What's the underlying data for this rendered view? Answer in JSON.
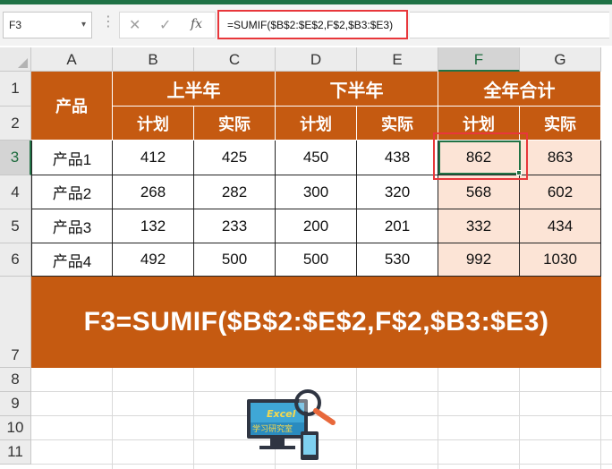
{
  "name_box": {
    "value": "F3",
    "dropdown_icon": "chevron-down-icon"
  },
  "formula_bar": {
    "cancel_icon": "cancel-x-icon",
    "enter_icon": "check-icon",
    "function_icon": "fx-icon",
    "fx_label": "fx",
    "formula": "=SUMIF($B$2:$E$2,F$2,$B3:$E3)"
  },
  "columns": [
    "A",
    "B",
    "C",
    "D",
    "E",
    "F",
    "G"
  ],
  "rows": [
    "1",
    "2",
    "3",
    "4",
    "5",
    "6",
    "7",
    "8",
    "9",
    "10",
    "11"
  ],
  "selected_column": "F",
  "selected_row": "3",
  "table": {
    "product_header": "产品",
    "groups": [
      "上半年",
      "下半年",
      "全年合计"
    ],
    "subheaders": [
      "计划",
      "实际",
      "计划",
      "实际",
      "计划",
      "实际"
    ],
    "data": [
      [
        "产品1",
        "412",
        "425",
        "450",
        "438",
        "862",
        "863"
      ],
      [
        "产品2",
        "268",
        "282",
        "300",
        "320",
        "568",
        "602"
      ],
      [
        "产品3",
        "132",
        "233",
        "200",
        "201",
        "332",
        "434"
      ],
      [
        "产品4",
        "492",
        "500",
        "500",
        "530",
        "992",
        "1030"
      ]
    ]
  },
  "banner_text": "F3=SUMIF($B$2:$E$2,F$2,$B3:$E3)",
  "logo": {
    "text": "Excel",
    "subtext": "学习研究室",
    "icon": "computer-magnifier-logo"
  },
  "colors": {
    "header_orange": "#c55a11",
    "total_fill": "#fce4d6",
    "excel_green": "#217346",
    "highlight_red": "#e8373b"
  }
}
